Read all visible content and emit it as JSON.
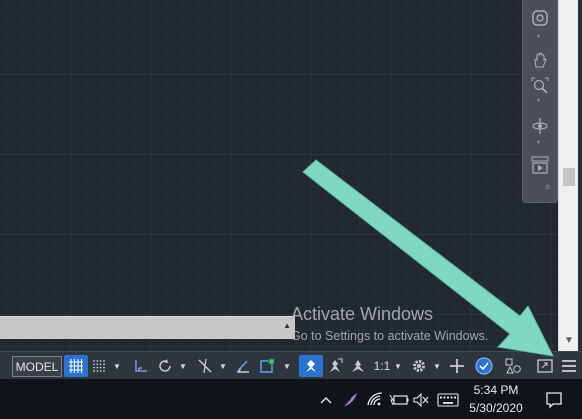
{
  "canvas": {
    "background": "#212830"
  },
  "navbar": {
    "items": [
      {
        "icon": "steering-wheel-icon"
      },
      {
        "icon": "pan-hand-icon"
      },
      {
        "icon": "zoom-extents-icon"
      },
      {
        "icon": "orbit-icon"
      },
      {
        "icon": "showmotion-icon"
      }
    ]
  },
  "watermark": {
    "title": "Activate Windows",
    "subtitle": "Go to Settings to activate Windows."
  },
  "statusbar": {
    "model_label": "MODEL",
    "scale_label": "1:1",
    "accent": "#2874d0"
  },
  "taskbar": {
    "time": "5:34 PM",
    "date": "5/30/2020"
  },
  "annotation": {
    "color": "#7fd8c0"
  }
}
